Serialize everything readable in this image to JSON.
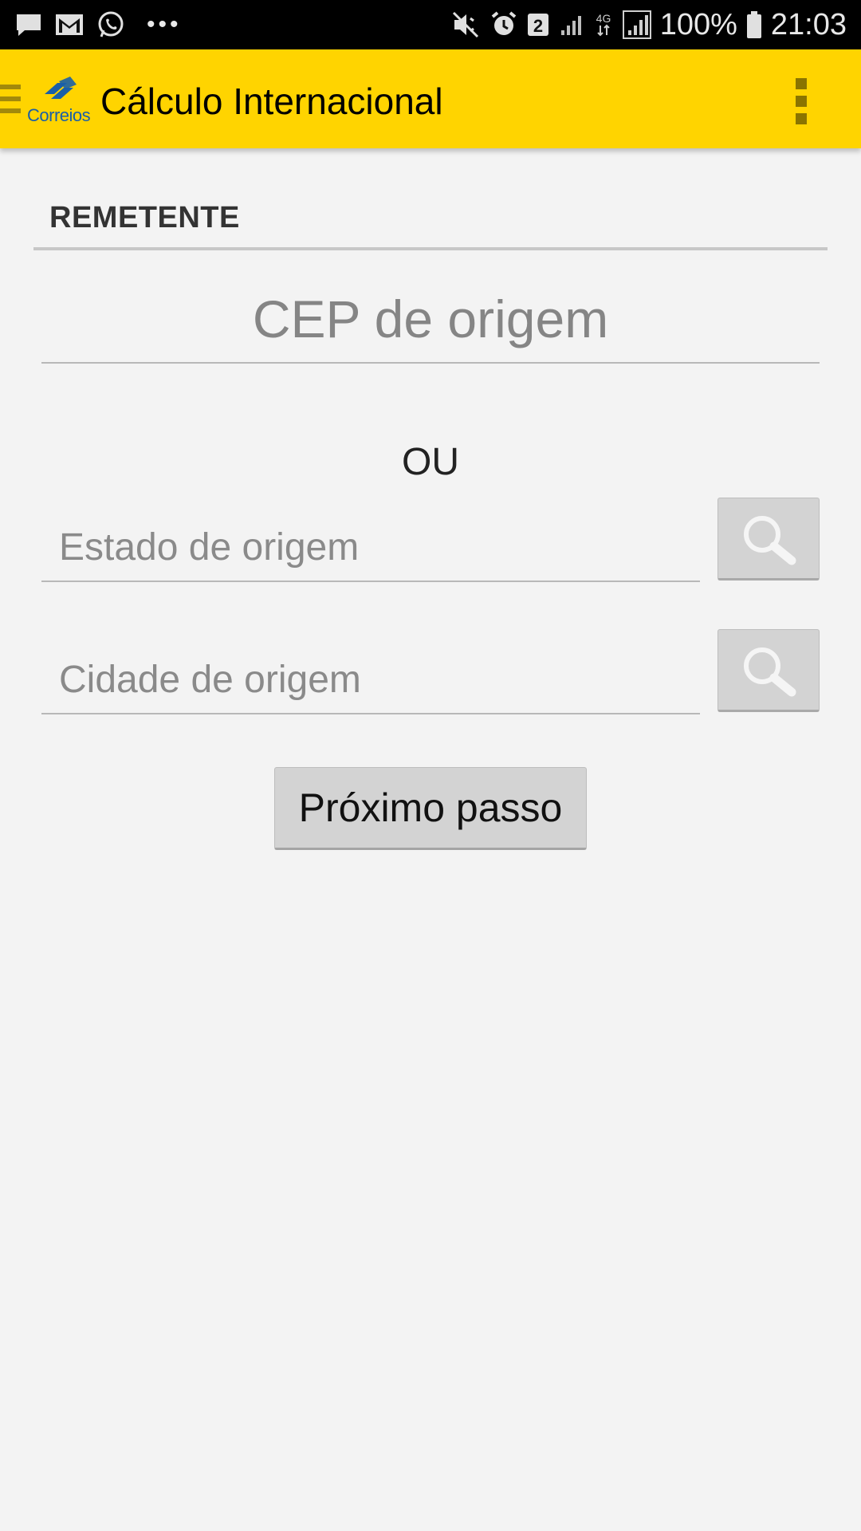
{
  "status_bar": {
    "battery_percent": "100%",
    "time": "21:03",
    "sim_badge": "2",
    "network_type": "4G",
    "overflow_dots": "•••",
    "left_icons": [
      "message-icon",
      "gmail-icon",
      "whatsapp-icon"
    ],
    "right_icons": [
      "mute-icon",
      "alarm-icon",
      "sim-badge-icon",
      "signal-icon",
      "4g-icon",
      "signal-icon",
      "battery-icon"
    ]
  },
  "app_bar": {
    "title": "Cálculo Internacional",
    "logo_text": "Correios",
    "background_color": "#ffd400",
    "icons": [
      "hamburger-menu-icon",
      "correios-logo",
      "overflow-menu-icon"
    ]
  },
  "form": {
    "section_title": "REMETENTE",
    "cep_placeholder": "CEP de origem",
    "cep_value": "",
    "or_label": "OU",
    "estado_placeholder": "Estado de origem",
    "estado_value": "",
    "cidade_placeholder": "Cidade de origem",
    "cidade_value": "",
    "search_icon": "search-icon",
    "next_button_label": "Próximo passo"
  }
}
